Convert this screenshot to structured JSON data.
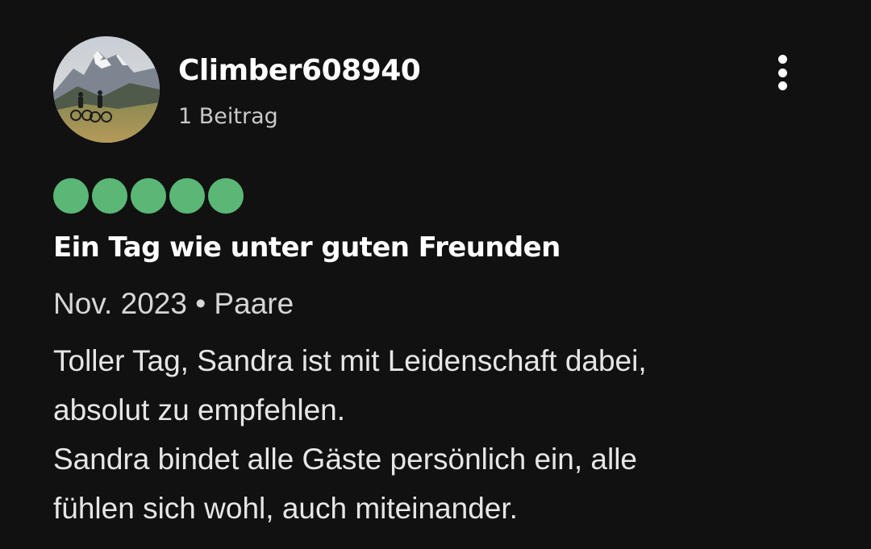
{
  "review": {
    "username": "Climber608940",
    "contributions": "1 Beitrag",
    "avatar_icon": "mountain-cyclists-avatar",
    "menu_icon": "more-vertical-icon",
    "rating": {
      "value": 5,
      "max": 5,
      "color": "#5ab775"
    },
    "title": "Ein Tag wie unter guten Freunden",
    "meta": "Nov. 2023 • Paare",
    "body_lines": [
      "Toller Tag, Sandra ist mit Leidenschaft dabei,",
      "absolut zu empfehlen.",
      "Sandra bindet alle Gäste persönlich ein, alle",
      "fühlen sich wohl, auch miteinander."
    ]
  }
}
